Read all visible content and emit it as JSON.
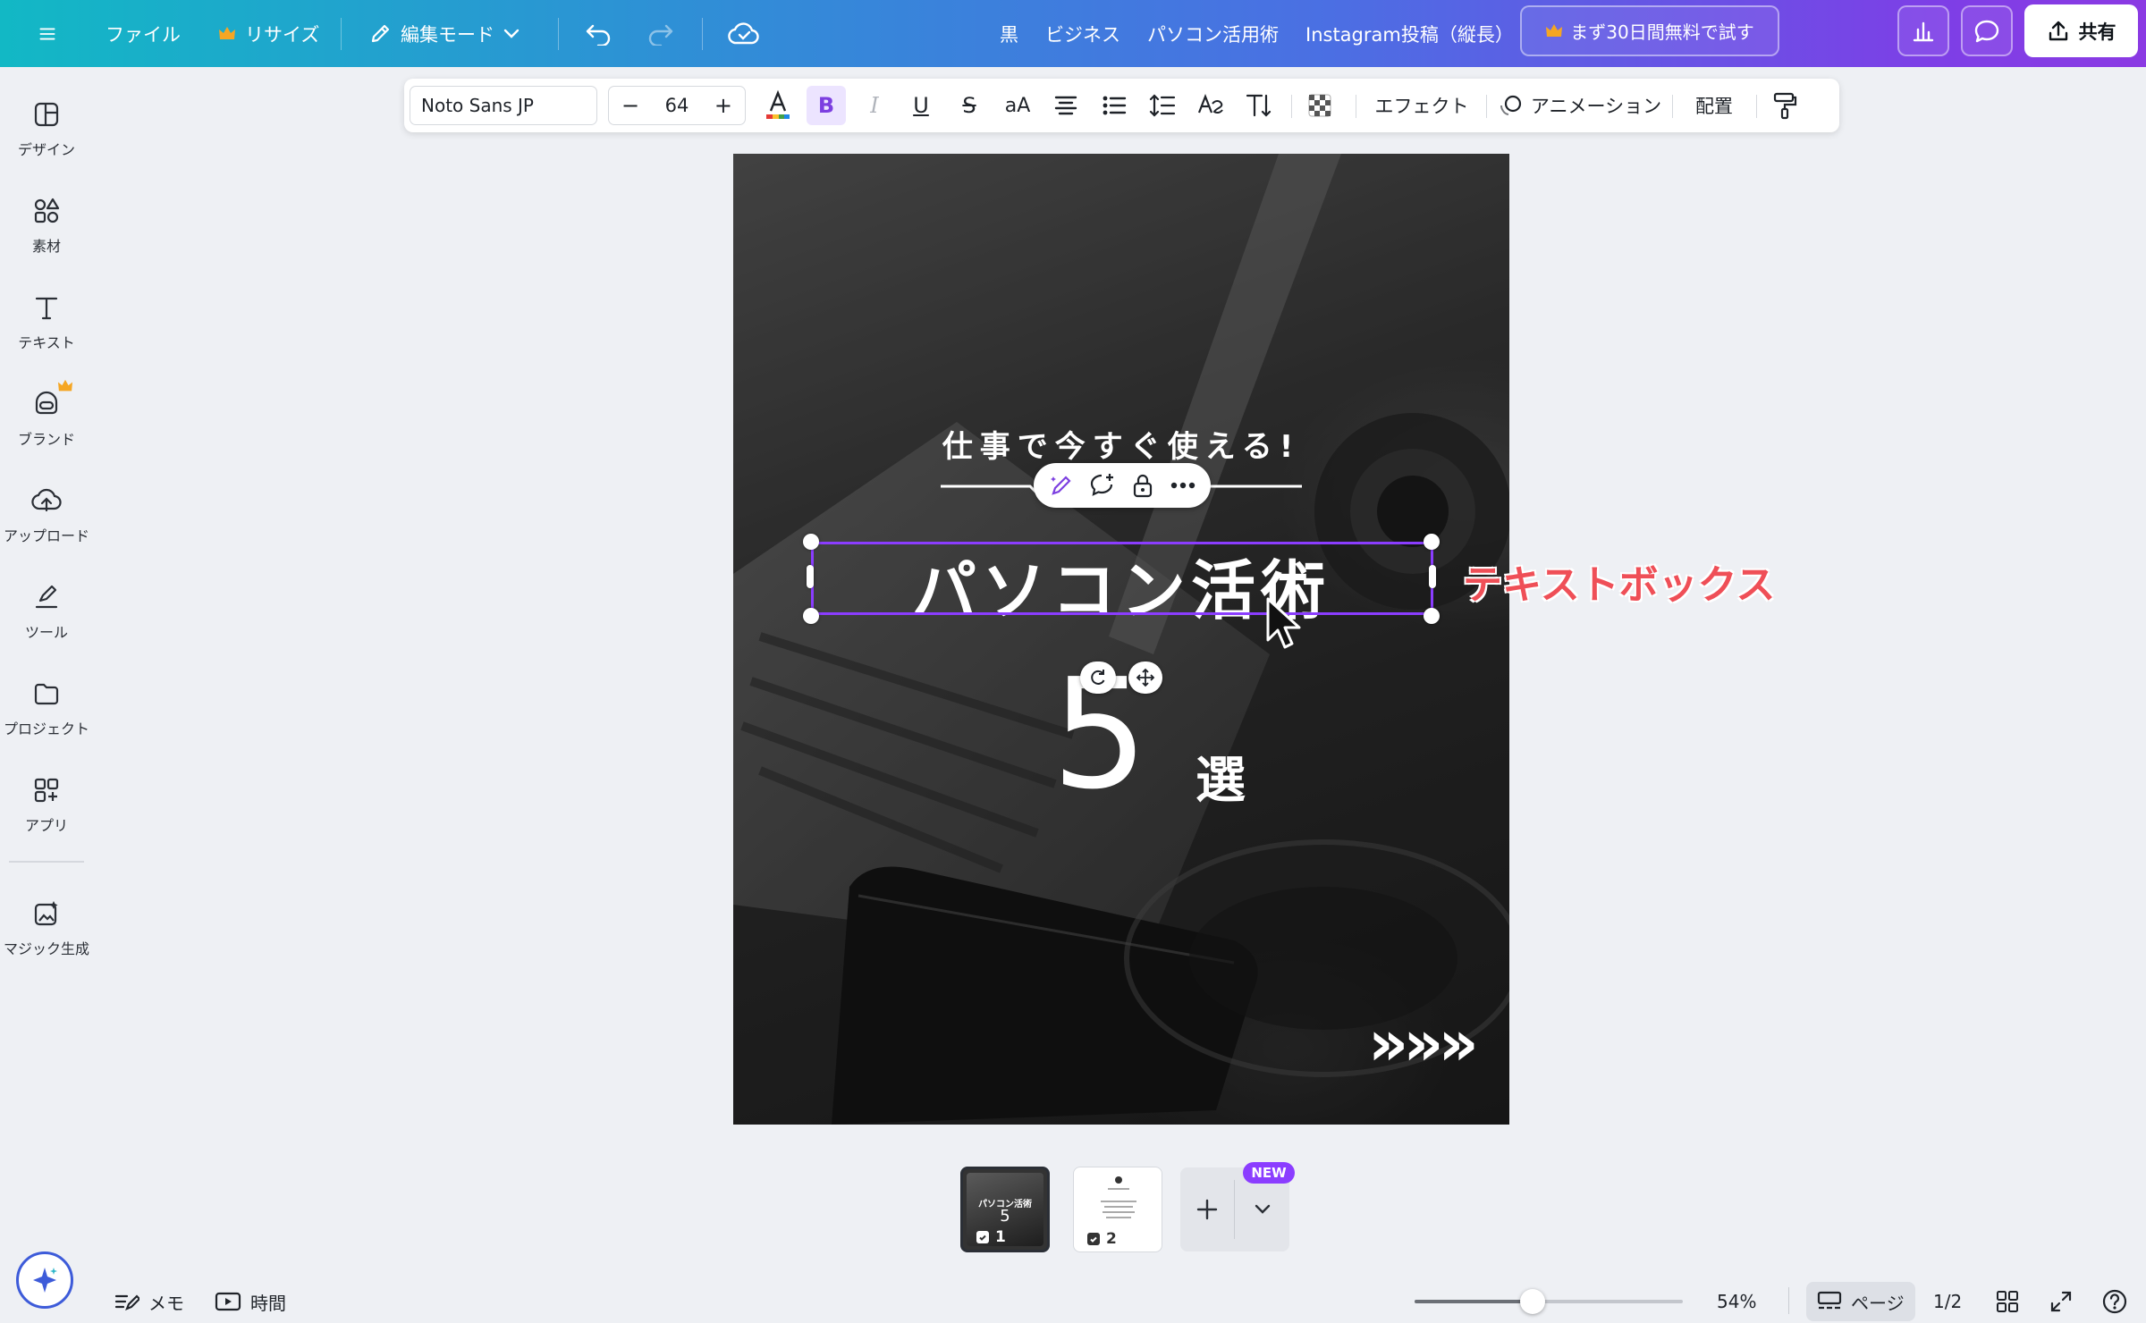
{
  "topbar": {
    "menu_icon": "hamburger-menu-icon",
    "file_label": "ファイル",
    "resize_label": "リサイズ",
    "edit_mode_label": "編集モード",
    "breadcrumb": [
      "黒",
      "ビジネス",
      "パソコン活用術",
      "Instagram投稿（縦長）"
    ],
    "trial_label": "まず30日間無料で試す",
    "share_label": "共有"
  },
  "sidebar": {
    "items": [
      {
        "label": "デザイン",
        "icon": "design-layout-icon"
      },
      {
        "label": "素材",
        "icon": "elements-shapes-icon"
      },
      {
        "label": "テキスト",
        "icon": "text-t-icon"
      },
      {
        "label": "ブランド",
        "icon": "brand-icon"
      },
      {
        "label": "アップロード",
        "icon": "cloud-upload-icon"
      },
      {
        "label": "ツール",
        "icon": "draw-tools-icon"
      },
      {
        "label": "プロジェクト",
        "icon": "folder-icon"
      },
      {
        "label": "アプリ",
        "icon": "apps-grid-icon"
      },
      {
        "label": "マジック生成",
        "icon": "magic-media-icon"
      }
    ]
  },
  "text_toolbar": {
    "font_name": "Noto Sans JP",
    "font_size": "64",
    "effects_label": "エフェクト",
    "animate_label": "アニメーション",
    "position_label": "配置"
  },
  "canvas": {
    "subtitle": "仕事で今すぐ使える!",
    "title": "パソコン活術",
    "number": "5",
    "number_suffix": "選",
    "arrows": "»»»"
  },
  "annotation_label": "テキストボックス",
  "pages": {
    "thumbs": [
      {
        "num": "1",
        "title": "パソコン活術",
        "number": "5"
      },
      {
        "num": "2"
      }
    ],
    "new_badge": "NEW",
    "indicator": "1/2"
  },
  "bottombar": {
    "notes_label": "メモ",
    "timer_label": "時間",
    "zoom_label": "54%",
    "zoom_value": 0.44,
    "pages_label": "ページ"
  },
  "colors": {
    "accent": "#8b3dff",
    "annotation": "#ef4f57",
    "crown": "#f5a623"
  }
}
